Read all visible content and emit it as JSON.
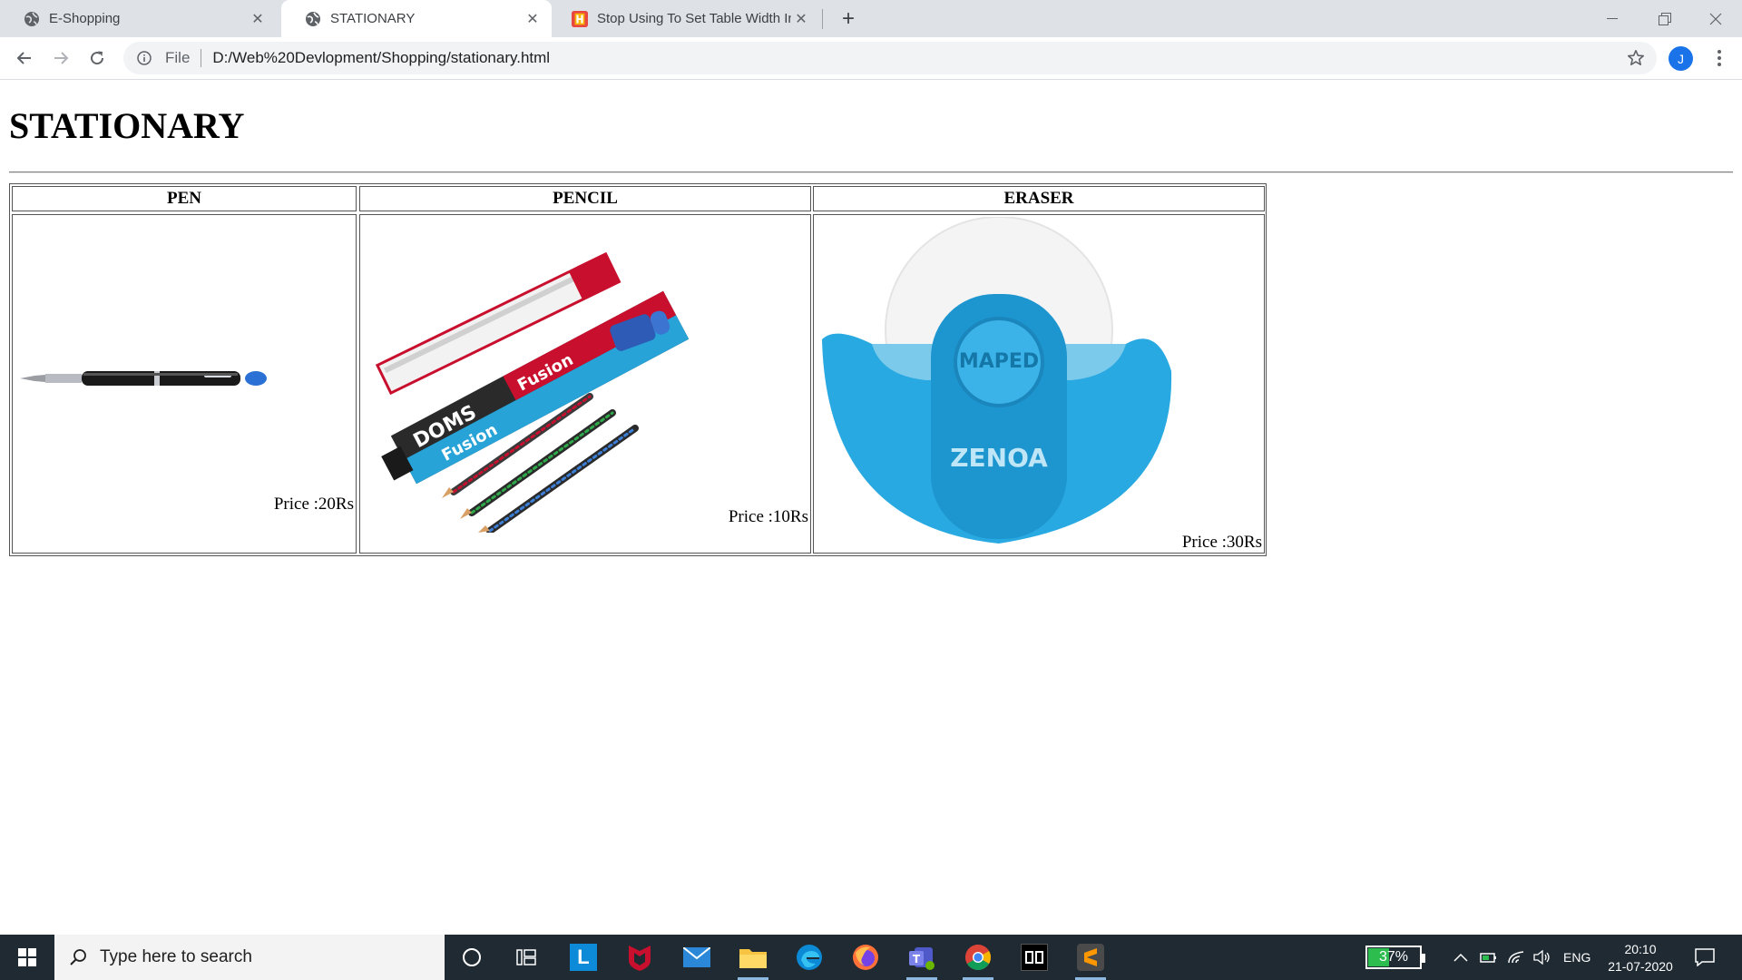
{
  "browser": {
    "tabs": [
      {
        "title": "E-Shopping",
        "active": false
      },
      {
        "title": "STATIONARY",
        "active": true
      },
      {
        "title": "Stop Using To Set Table Width In",
        "active": false
      }
    ],
    "omnibox": {
      "scheme": "File",
      "url": "D:/Web%20Devlopment/Shopping/stationary.html"
    },
    "profile_initial": "J"
  },
  "page": {
    "heading": "STATIONARY",
    "columns": [
      "PEN",
      "PENCIL",
      "ERASER"
    ],
    "prices": [
      "Price :20Rs",
      "Price :10Rs",
      "Price :30Rs"
    ],
    "pencil_box_text": [
      "DOMS",
      "Fusion"
    ],
    "eraser_text": [
      "MAPED",
      "ZENOA"
    ]
  },
  "taskbar": {
    "search_placeholder": "Type here to search",
    "battery": "37%",
    "language": "ENG",
    "time": "20:10",
    "date": "21-07-2020"
  },
  "colors": {
    "tabstrip": "#dee1e6",
    "taskbar": "#1f2a33",
    "accent_blue": "#1a73e8",
    "eraser_blue": "#29a9e1"
  }
}
